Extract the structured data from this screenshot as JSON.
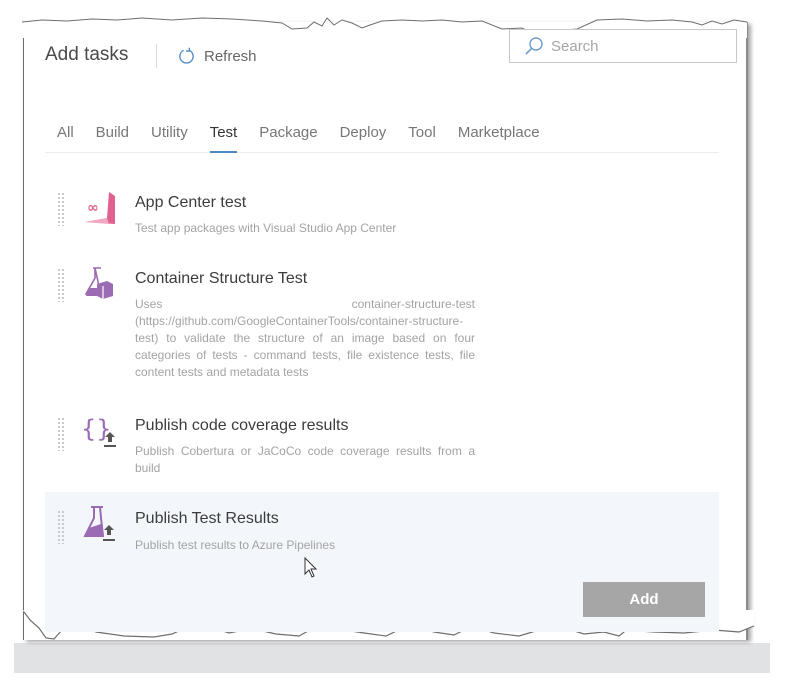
{
  "header": {
    "title": "Add tasks",
    "refresh_label": "Refresh",
    "refresh_icon": "refresh-icon",
    "search_placeholder": "Search",
    "search_value": "",
    "search_icon": "search-icon"
  },
  "tabs": [
    {
      "label": "All",
      "active": false
    },
    {
      "label": "Build",
      "active": false
    },
    {
      "label": "Utility",
      "active": false
    },
    {
      "label": "Test",
      "active": true
    },
    {
      "label": "Package",
      "active": false
    },
    {
      "label": "Deploy",
      "active": false
    },
    {
      "label": "Tool",
      "active": false
    },
    {
      "label": "Marketplace",
      "active": false
    }
  ],
  "tasks": [
    {
      "title": "App Center test",
      "description": "Test app packages with Visual Studio App Center",
      "icon": "app-center-icon",
      "selected": false
    },
    {
      "title": "Container Structure Test",
      "description": "Uses container-structure-test (https://github.com/GoogleContainerTools/container-structure-test) to validate the structure of an image based on four categories of tests - command tests, file existence tests, file content tests and metadata tests",
      "icon": "flask-container-icon",
      "selected": false
    },
    {
      "title": "Publish code coverage results",
      "description": "Publish Cobertura or JaCoCo code coverage results from a build",
      "icon": "code-coverage-upload-icon",
      "selected": false
    },
    {
      "title": "Publish Test Results",
      "description": "Publish test results to Azure Pipelines",
      "icon": "flask-upload-icon",
      "selected": true
    }
  ],
  "actions": {
    "add_label": "Add"
  },
  "colors": {
    "accent": "#4e8bc4",
    "icon_purple": "#9b6bb3",
    "icon_pink": "#e0608f",
    "selected_row": "#f3f7fb",
    "add_button": "#a6a6a6"
  }
}
